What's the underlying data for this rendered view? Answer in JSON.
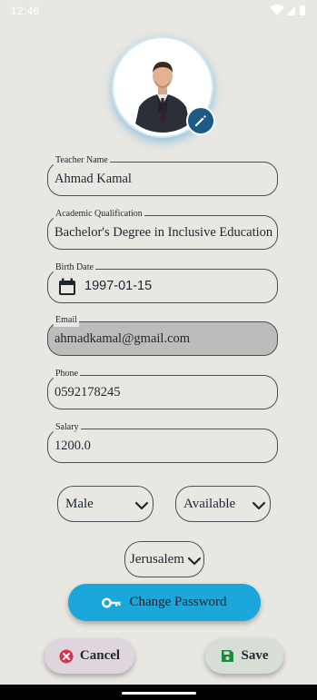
{
  "status_bar": {
    "time": "12:46"
  },
  "form": {
    "teacher_name": {
      "label": "Teacher Name",
      "value": "Ahmad Kamal"
    },
    "qualification": {
      "label": "Academic Qualification",
      "value": "Bachelor's Degree in Inclusive Education"
    },
    "birth_date": {
      "label": "Birth Date",
      "value": "1997-01-15"
    },
    "email": {
      "label": "Email",
      "value": "ahmadkamal@gmail.com"
    },
    "phone": {
      "label": "Phone",
      "value": "0592178245"
    },
    "salary": {
      "label": "Salary",
      "value": "1200.0"
    },
    "gender": {
      "selected": "Male"
    },
    "availability": {
      "selected": "Available"
    },
    "city": {
      "selected": "Jerusalem"
    }
  },
  "buttons": {
    "change_password": "Change Password",
    "cancel": "Cancel",
    "save": "Save"
  },
  "colors": {
    "background": "#e9e7e2",
    "primary": "#1aa7dc",
    "edit_badge": "#1d5a86",
    "cancel_icon": "#d8334a",
    "save_icon": "#1e8a3c",
    "disabled_field": "#bdbcbb"
  },
  "icons": {
    "edit": "pencil-icon",
    "calendar": "calendar-icon",
    "key": "key-icon",
    "cancel": "cancel-circle-icon",
    "save": "floppy-disk-icon",
    "dropdown": "chevron-down-icon"
  }
}
